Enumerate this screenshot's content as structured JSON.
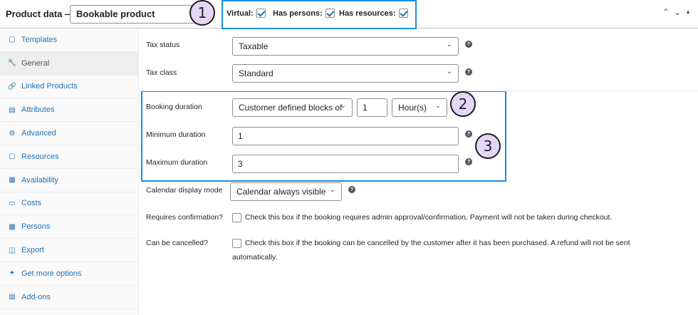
{
  "header": {
    "title": "Product data —",
    "product_type": "Bookable product",
    "virtual_label": "Virtual:",
    "virtual_checked": true,
    "persons_label": "Has persons:",
    "persons_checked": true,
    "resources_label": "Has resources:",
    "resources_checked": true
  },
  "callouts": [
    "1",
    "2",
    "3"
  ],
  "sidebar": {
    "items": [
      {
        "label": "Templates",
        "icon": "template-icon"
      },
      {
        "label": "General",
        "icon": "wrench-icon",
        "active": true
      },
      {
        "label": "Linked Products",
        "icon": "link-icon"
      },
      {
        "label": "Attributes",
        "icon": "list-icon"
      },
      {
        "label": "Advanced",
        "icon": "gear-icon"
      },
      {
        "label": "Resources",
        "icon": "box-icon"
      },
      {
        "label": "Availability",
        "icon": "calendar-icon"
      },
      {
        "label": "Costs",
        "icon": "card-icon"
      },
      {
        "label": "Persons",
        "icon": "person-icon"
      },
      {
        "label": "Export",
        "icon": "database-icon"
      },
      {
        "label": "Get more options",
        "icon": "plugin-icon"
      },
      {
        "label": "Add-ons",
        "icon": "addons-icon"
      }
    ]
  },
  "form": {
    "tax_status_label": "Tax status",
    "tax_status_value": "Taxable",
    "tax_class_label": "Tax class",
    "tax_class_value": "Standard",
    "booking_duration_label": "Booking duration",
    "booking_duration_type": "Customer defined blocks of",
    "booking_duration_amount": "1",
    "booking_duration_unit": "Hour(s)",
    "min_duration_label": "Minimum duration",
    "min_duration_value": "1",
    "max_duration_label": "Maximum duration",
    "max_duration_value": "3",
    "calendar_mode_label": "Calendar display mode",
    "calendar_mode_value": "Calendar always visible",
    "requires_confirmation_label": "Requires confirmation?",
    "requires_confirmation_desc": "Check this box if the booking requires admin approval/confirmation. Payment will not be taken during checkout.",
    "can_cancel_label": "Can be cancelled?",
    "can_cancel_desc_line1": "Check this box if the booking can be cancelled by the customer after it has been purchased. A refund will not be sent",
    "can_cancel_desc_line2": "automatically."
  },
  "colors": {
    "highlight": "#1c8ee6",
    "callout_fill": "#e3d7f5",
    "link": "#2271b1"
  }
}
